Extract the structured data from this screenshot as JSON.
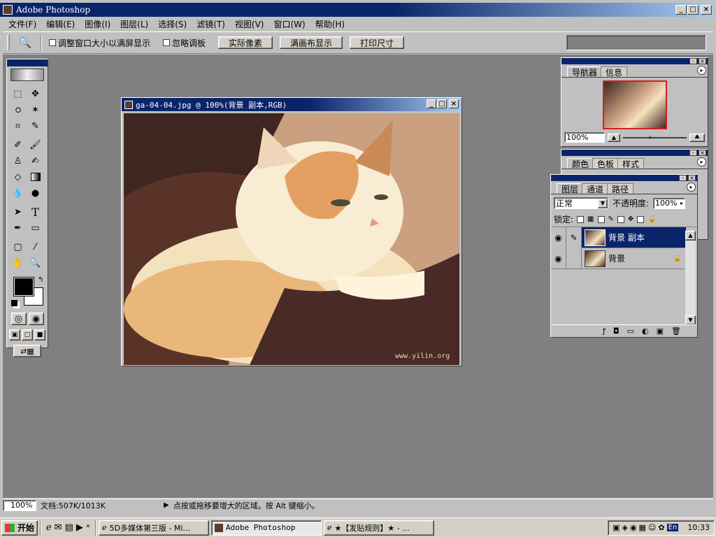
{
  "app": {
    "title": "Adobe Photoshop"
  },
  "menu": [
    "文件(F)",
    "编辑(E)",
    "图像(I)",
    "图层(L)",
    "选择(S)",
    "滤镜(T)",
    "视图(V)",
    "窗口(W)",
    "帮助(H)"
  ],
  "options": {
    "resize_windows": "调整窗口大小以满屏显示",
    "ignore_palettes": "忽略调板",
    "actual_pixels": "实际像素",
    "fit_on_screen": "满画布显示",
    "print_size": "打印尺寸"
  },
  "document": {
    "title": "ga-04-04.jpg @ 100%(背景 副本,RGB)",
    "watermark": "www.yilin.org"
  },
  "navigator": {
    "tabs": [
      "导航器",
      "信息"
    ],
    "zoom": "100%"
  },
  "color_panel": {
    "tabs": [
      "颜色",
      "色板",
      "样式"
    ]
  },
  "layers_panel": {
    "tabs": [
      "图层",
      "通道",
      "路径"
    ],
    "blend_mode": "正常",
    "opacity_label": "不透明度:",
    "opacity_value": "100%",
    "lock_label": "锁定:",
    "layers": [
      {
        "name": "背景 副本",
        "selected": true
      },
      {
        "name": "背景",
        "selected": false
      }
    ]
  },
  "status": {
    "zoom": "100%",
    "doc_size": "文档:507K/1013K",
    "hint": "点按或拖移要增大的区域。按 Alt 键缩小。"
  },
  "taskbar": {
    "start": "开始",
    "tasks": [
      "5D多媒体第三版 - Mi...",
      "Adobe Photoshop",
      "★【发贴规则】★ - ..."
    ],
    "lang": "En",
    "clock": "10:33"
  },
  "colors": {
    "titlebar": "#0a246a",
    "workspace": "#808080",
    "chrome": "#d4d0c8"
  }
}
